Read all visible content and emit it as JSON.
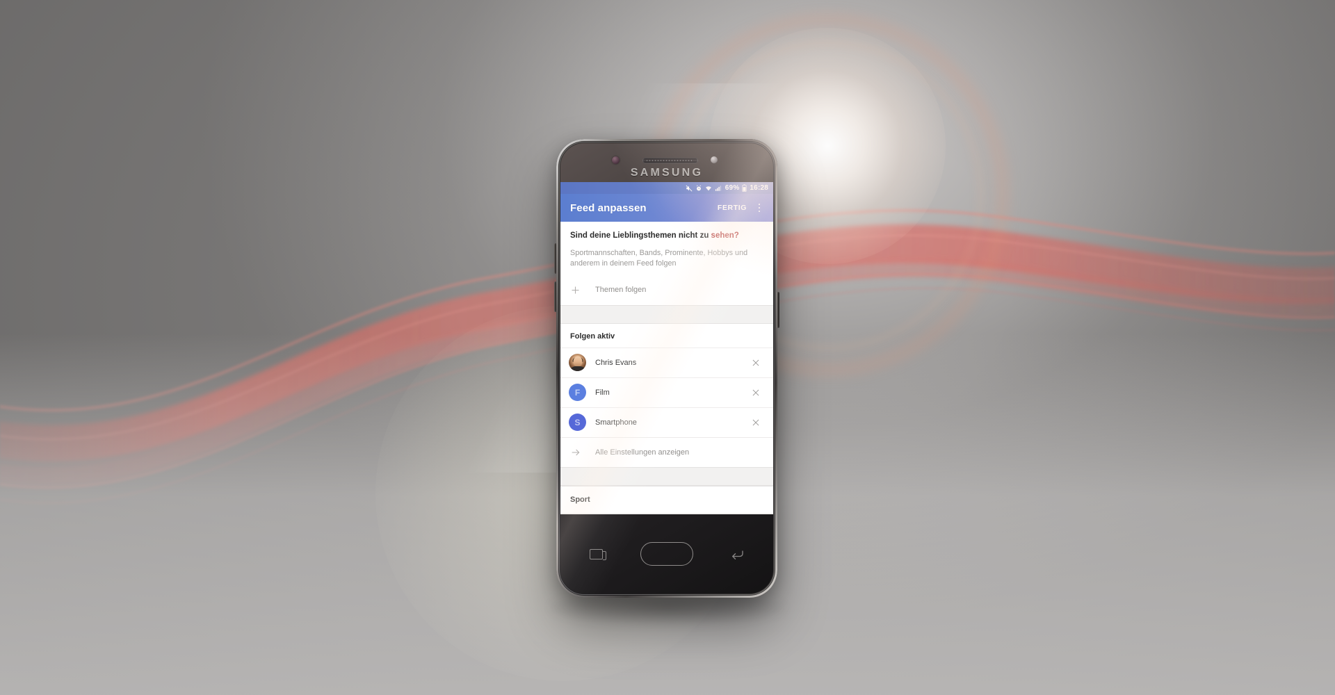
{
  "scene": {
    "background_style": "gray-gradient-with-red-wave-ribbons",
    "accent_red": "#d96b63",
    "phone_brand": "SAMSUNG"
  },
  "statusbar": {
    "icons": [
      "mute-icon",
      "alarm-icon",
      "wifi-icon",
      "signal-icon"
    ],
    "battery_percent": "69%",
    "battery_icon": "battery-icon",
    "time": "16:28"
  },
  "appbar": {
    "title": "Feed anpassen",
    "action_label": "FERTIG",
    "overflow_icon": "more-vertical-icon",
    "background_color": "#6b86d2"
  },
  "promo": {
    "title_plain": "Sind deine Lieblingsthemen nicht zu ",
    "title_highlight": "sehen?",
    "body": "Sportmannschaften, Bands, Prominente, Hobbys und anderem in deinem Feed folgen",
    "add_row": {
      "icon": "plus-icon",
      "label": "Themen folgen"
    }
  },
  "following": {
    "section_title": "Folgen aktiv",
    "items": [
      {
        "name": "Chris Evans",
        "avatar_type": "photo",
        "avatar_initial": "",
        "avatar_color": "#8a5c3c",
        "remove_icon": "close-icon"
      },
      {
        "name": "Film",
        "avatar_type": "initial",
        "avatar_initial": "F",
        "avatar_color": "#5b7fe0",
        "remove_icon": "close-icon"
      },
      {
        "name": "Smartphone",
        "avatar_type": "initial",
        "avatar_initial": "S",
        "avatar_color": "#5568d8",
        "remove_icon": "close-icon"
      }
    ],
    "settings_row": {
      "icon": "arrow-right-icon",
      "label": "Alle Einstellungen anzeigen"
    }
  },
  "next_section": {
    "title": "Sport"
  },
  "navbar": {
    "recents_icon": "recents-icon",
    "home_icon": "home-icon",
    "back_icon": "back-icon"
  }
}
